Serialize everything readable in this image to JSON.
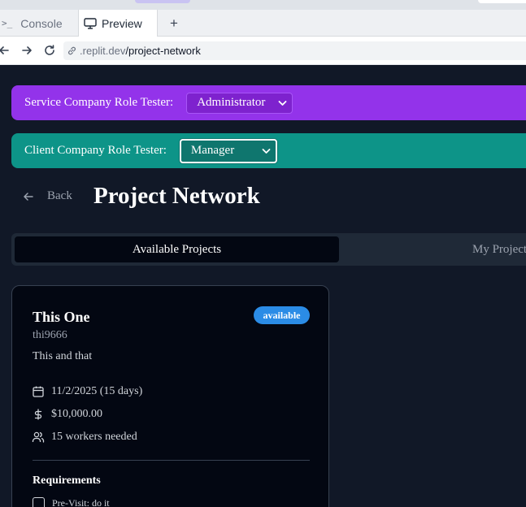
{
  "browser": {
    "tabs": [
      {
        "label": "Console",
        "icon": "terminal-icon"
      },
      {
        "label": "Preview",
        "icon": "monitor-icon"
      }
    ],
    "new_tab": "+",
    "url_prefix": ".replit.dev",
    "url_path": "/project-network"
  },
  "role_testers": {
    "service": {
      "label": "Service Company Role Tester:",
      "value": "Administrator",
      "color": "#9333ea"
    },
    "client": {
      "label": "Client Company Role Tester:",
      "value": "Manager",
      "color": "#0d9488"
    }
  },
  "header": {
    "back_label": "Back",
    "title": "Project Network"
  },
  "tabs": {
    "available": "Available Projects",
    "mine": "My Projects"
  },
  "project": {
    "title": "This One",
    "status": "available",
    "status_color": "#2b8ce6",
    "code": "thi9666",
    "description": "This and that",
    "date": "11/2/2025 (15 days)",
    "budget": "$10,000.00",
    "workers": "15 workers needed",
    "requirements_title": "Requirements",
    "requirements": [
      {
        "label": "Pre-Visit: do it",
        "checked": false
      }
    ]
  }
}
